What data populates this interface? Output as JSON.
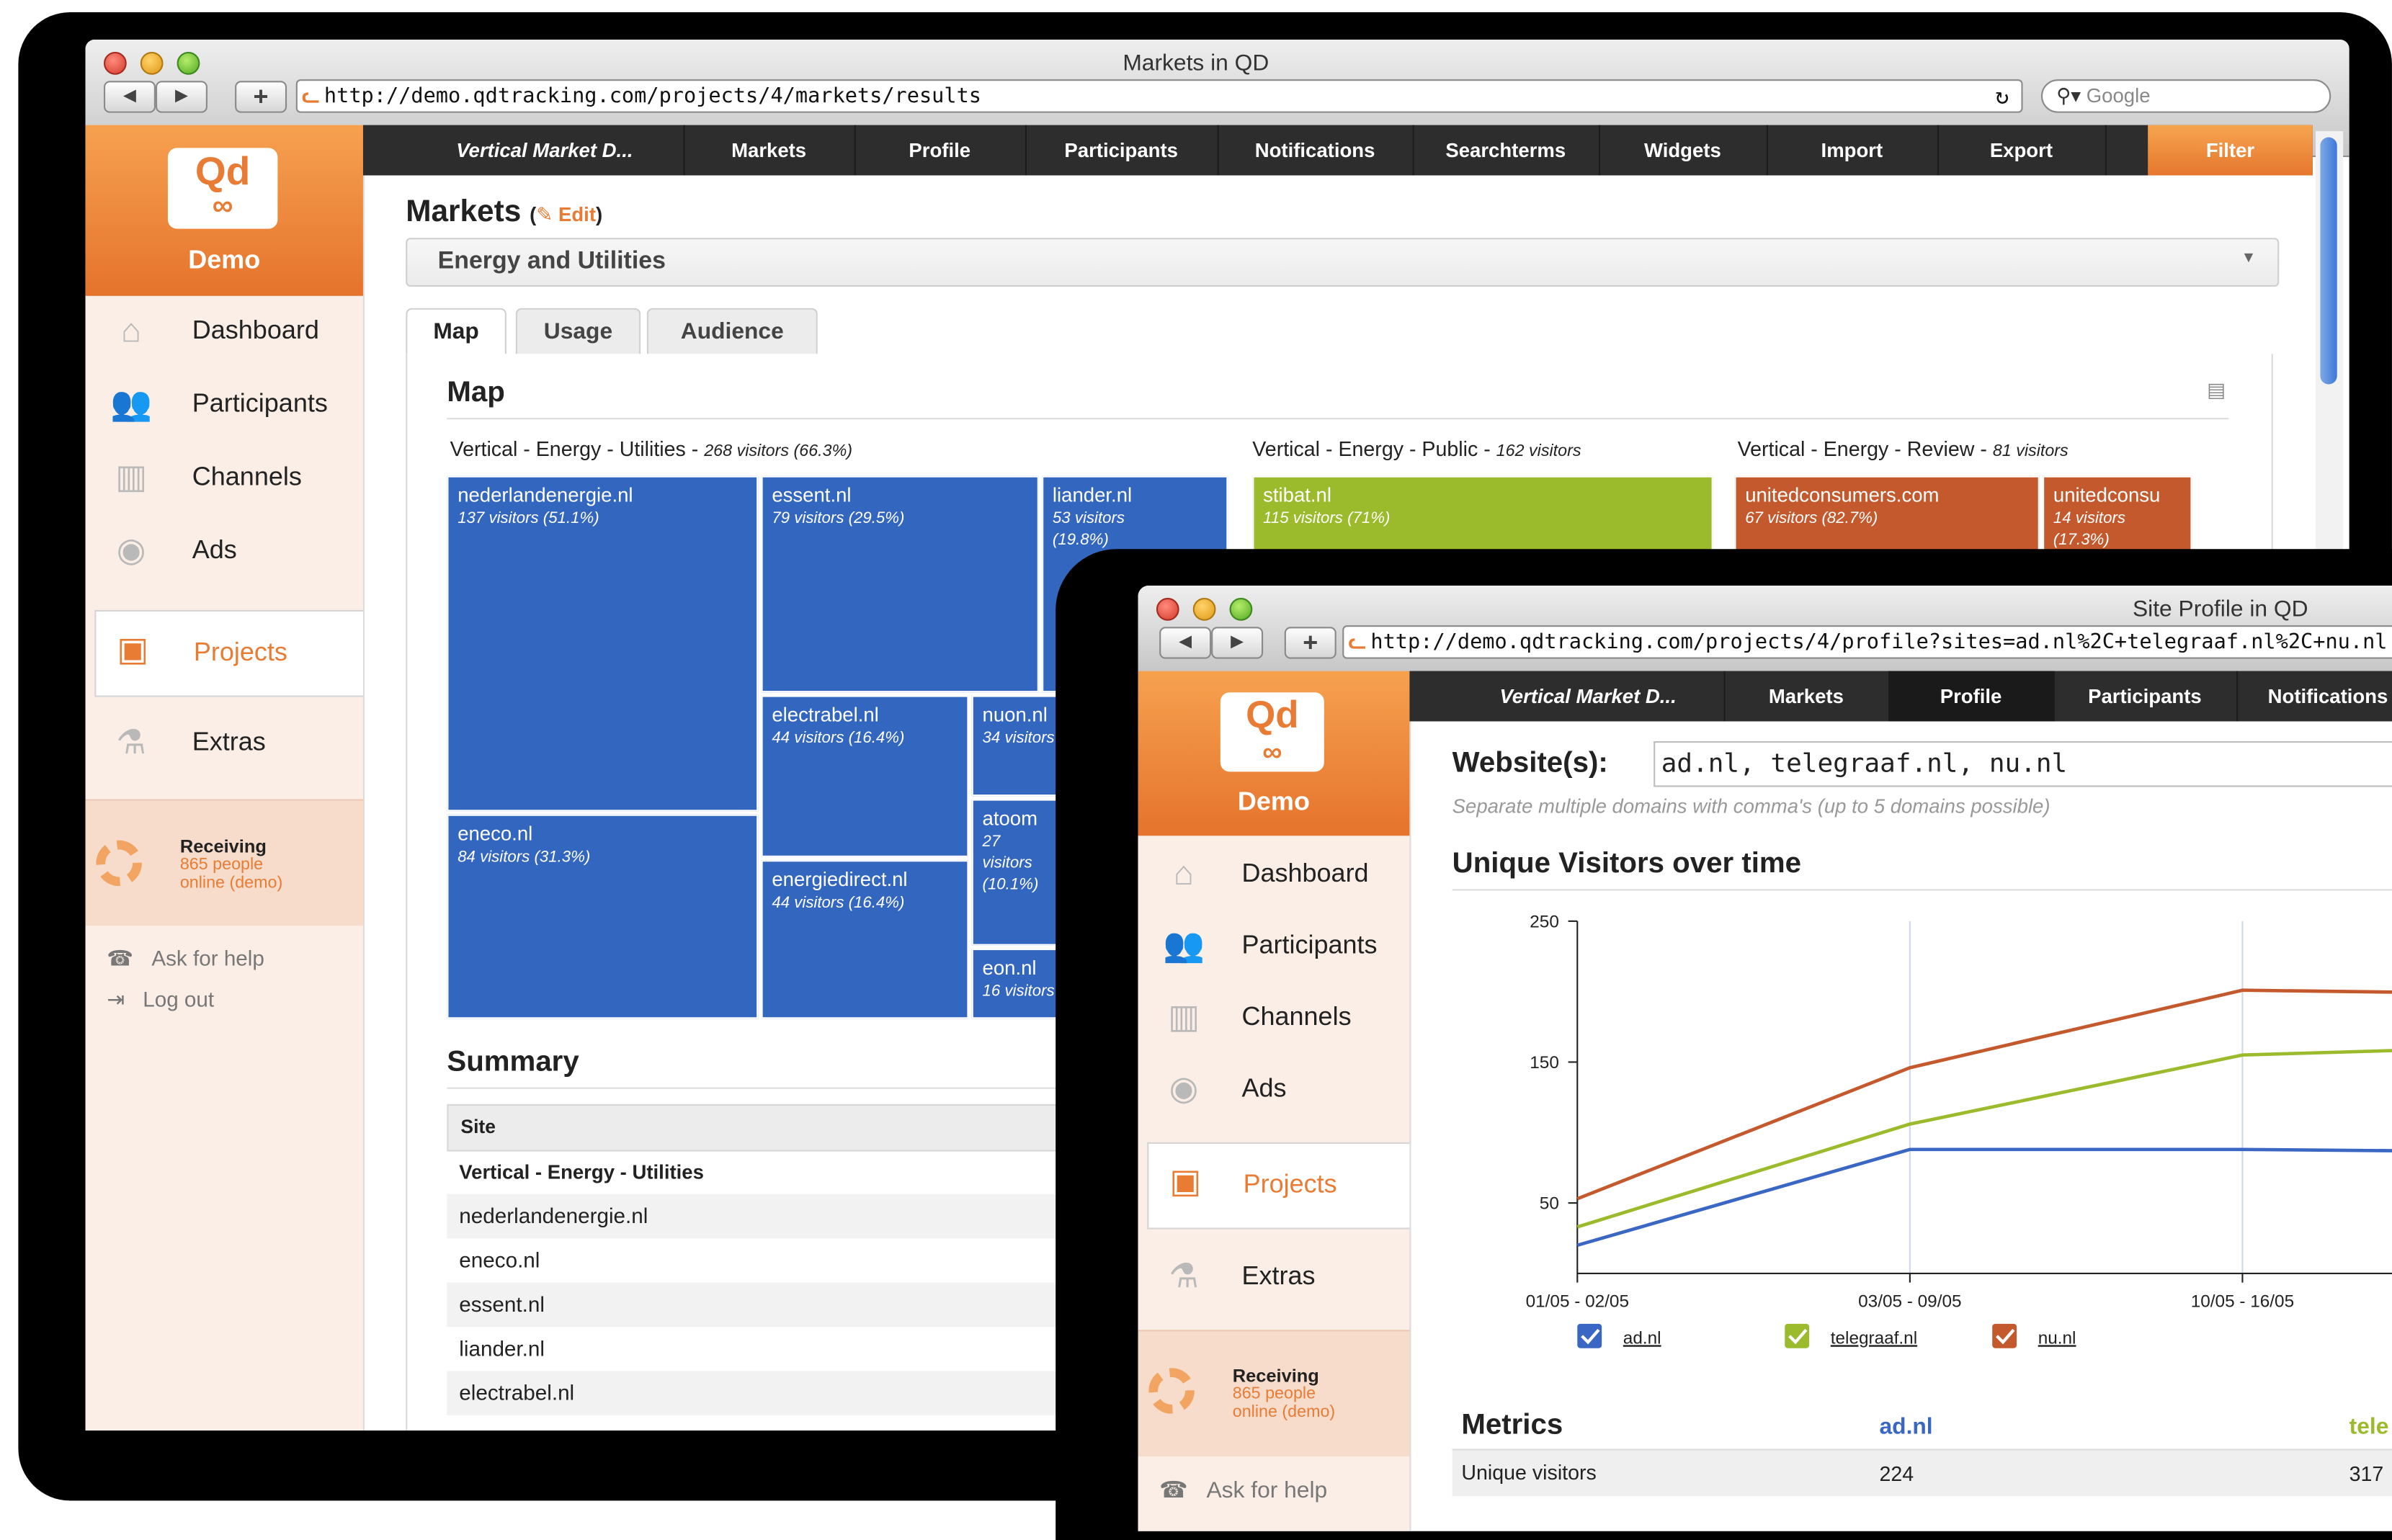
{
  "window1": {
    "title": "Markets in QD",
    "nav_back": "◀",
    "nav_forward": "▶",
    "nav_add": "+",
    "url": "http://demo.qdtracking.com/projects/4/markets/results",
    "search_placeholder": "Google",
    "logo_text": "Qd",
    "logo_sub": "∞",
    "account": "Demo",
    "sidebar": [
      {
        "label": "Dashboard",
        "icon": "home-icon"
      },
      {
        "label": "Participants",
        "icon": "people-icon"
      },
      {
        "label": "Channels",
        "icon": "sliders-icon"
      },
      {
        "label": "Ads",
        "icon": "eye-icon"
      },
      {
        "label": "Projects",
        "icon": "briefcase-icon"
      },
      {
        "label": "Extras",
        "icon": "flask-icon"
      }
    ],
    "receiving": {
      "title": "Receiving",
      "line1": "865 people",
      "line2": "online (demo)"
    },
    "help": "Ask for help",
    "logout": "Log out",
    "topnav": [
      "Vertical Market D...",
      "Markets",
      "Profile",
      "Participants",
      "Notifications",
      "Searchterms",
      "Widgets",
      "Import",
      "Export",
      "Filter"
    ],
    "heading": "Markets",
    "edit": "Edit",
    "select_value": "Energy and Utilities",
    "tabs": [
      "Map",
      "Usage",
      "Audience"
    ],
    "map_title": "Map",
    "groups": [
      {
        "name": "Vertical - Energy - Utilities",
        "stat": "268 visitors (66.3%)"
      },
      {
        "name": "Vertical - Energy - Public",
        "stat": "162 visitors"
      },
      {
        "name": "Vertical - Energy - Review",
        "stat": "81 visitors"
      }
    ],
    "treemap": [
      {
        "name": "nederlandenergie.nl",
        "stat": "137 visitors (51.1%)"
      },
      {
        "name": "essent.nl",
        "stat": "79 visitors (29.5%)"
      },
      {
        "name": "liander.nl",
        "stat": "53 visitors (19.8%)"
      },
      {
        "name": "electrabel.nl",
        "stat": "44 visitors (16.4%)"
      },
      {
        "name": "nuon.nl",
        "stat": "34 visitors"
      },
      {
        "name": "atoom",
        "stat": "27 visitors (10.1%)"
      },
      {
        "name": "eneco.nl",
        "stat": "84 visitors (31.3%)"
      },
      {
        "name": "energiedirect.nl",
        "stat": "44 visitors (16.4%)"
      },
      {
        "name": "eon.nl",
        "stat": "16 visitors"
      },
      {
        "name": "stibat.nl",
        "stat": "115 visitors (71%)"
      },
      {
        "name": "unitedconsumers.com",
        "stat": "67 visitors (82.7%)"
      },
      {
        "name": "unitedconsu",
        "stat": "14 visitors (17.3%)"
      }
    ],
    "summary_title": "Summary",
    "summary_header": "Site",
    "summary_group": "Vertical - Energy - Utilities",
    "summary_rows": [
      "nederlandenergie.nl",
      "eneco.nl",
      "essent.nl",
      "liander.nl",
      "electrabel.nl"
    ]
  },
  "window2": {
    "title": "Site Profile in QD",
    "url": "http://demo.qdtracking.com/projects/4/profile?sites=ad.nl%2C+telegraaf.nl%2C+nu.nl",
    "account": "Demo",
    "topnav": [
      "Vertical Market D...",
      "Markets",
      "Profile",
      "Participants",
      "Notifications"
    ],
    "sidebar": [
      "Dashboard",
      "Participants",
      "Channels",
      "Ads",
      "Projects",
      "Extras"
    ],
    "receiving": {
      "title": "Receiving",
      "line1": "865 people",
      "line2": "online (demo)"
    },
    "help": "Ask for help",
    "website_label": "Website(s):",
    "website_value": "ad.nl, telegraaf.nl, nu.nl",
    "website_hint": "Separate multiple domains with comma's (up to 5 domains possible)",
    "chart_title": "Unique Visitors over time",
    "metrics_title": "Metrics",
    "metrics_cols": [
      "ad.nl",
      "tele"
    ],
    "metrics_row_label": "Unique visitors",
    "metrics_row_values": [
      "224",
      "317"
    ]
  },
  "chart_data": {
    "type": "line",
    "title": "Unique Visitors over time",
    "x": [
      "01/05 - 02/05",
      "03/05 - 09/05",
      "10/05 - 16/05",
      ""
    ],
    "yticks": [
      50,
      150,
      250
    ],
    "ylim": [
      0,
      250
    ],
    "series": [
      {
        "name": "ad.nl",
        "color": "#3a66c4",
        "values": [
          20,
          88,
          88,
          86
        ]
      },
      {
        "name": "telegraaf.nl",
        "color": "#9bbb2c",
        "values": [
          33,
          106,
          155,
          162
        ]
      },
      {
        "name": "nu.nl",
        "color": "#c4592d",
        "values": [
          53,
          146,
          201,
          198
        ]
      }
    ],
    "legend": "bottom"
  },
  "colors": {
    "accent": "#e97c34",
    "nav": "#2d2d2d",
    "blue": "#3366bf",
    "green": "#9bbb2c",
    "brown": "#c4592d"
  }
}
